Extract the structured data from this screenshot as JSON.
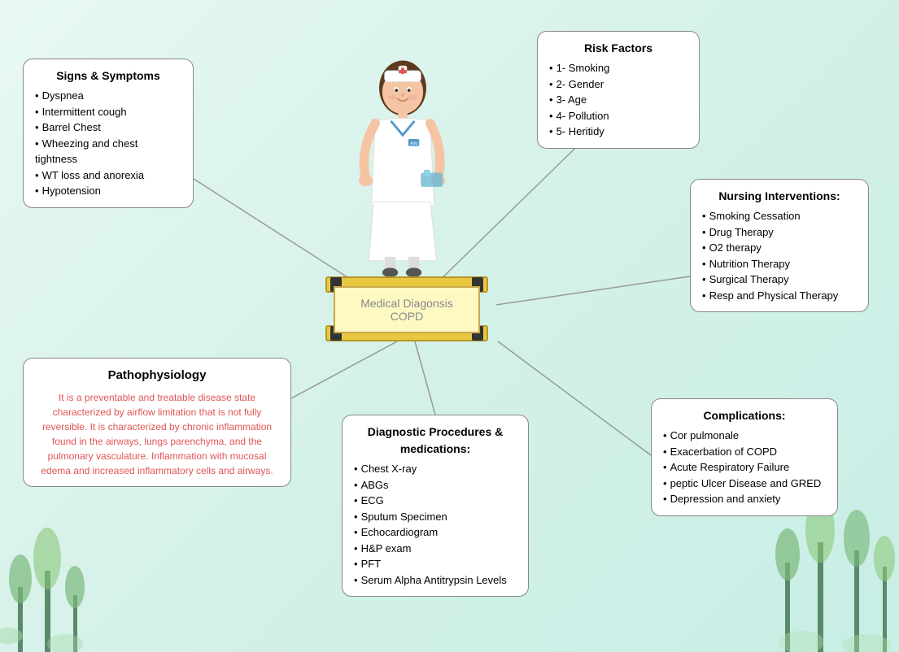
{
  "background": {
    "color": "#e0f5f0"
  },
  "center": {
    "title": "Medical Diagonsis",
    "subtitle": "COPD"
  },
  "signs_symptoms": {
    "title": "Signs & Symptoms",
    "items": [
      "Dyspnea",
      "Intermittent cough",
      "Barrel Chest",
      "Wheezing and chest tightness",
      "WT loss and anorexia",
      "Hypotension"
    ]
  },
  "risk_factors": {
    "title": "Risk Factors",
    "items": [
      "1- Smoking",
      "2- Gender",
      "3- Age",
      "4- Pollution",
      "5- Heritidy"
    ]
  },
  "nursing": {
    "title": "Nursing Interventions:",
    "items": [
      "Smoking Cessation",
      "Drug Therapy",
      "O2 therapy",
      "Nutrition Therapy",
      "Surgical Therapy",
      "Resp and Physical Therapy"
    ]
  },
  "pathophysiology": {
    "title": "Pathophysiology",
    "text": "It is a preventable and treatable disease state characterized by airflow limitation that is not fully reversible. It is characterized by chronic inflammation found in the airways, lungs parenchyma, and the pulmonary vasculature. Inflammation with mucosal edema and increased inflammatory cells and airways."
  },
  "diagnostic": {
    "title": "Diagnostic Procedures & medications:",
    "items": [
      "Chest X-ray",
      "ABGs",
      "ECG",
      "Sputum Specimen",
      "Echocardiogram",
      "H&P exam",
      "PFT",
      "Serum Alpha Antitrypsin Levels"
    ]
  },
  "complications": {
    "title": "Complications:",
    "items": [
      "Cor pulmonale",
      "Exacerbation of COPD",
      "Acute Respiratory Failure",
      "peptic Ulcer Disease and GRED",
      "Depression and anxiety"
    ]
  }
}
